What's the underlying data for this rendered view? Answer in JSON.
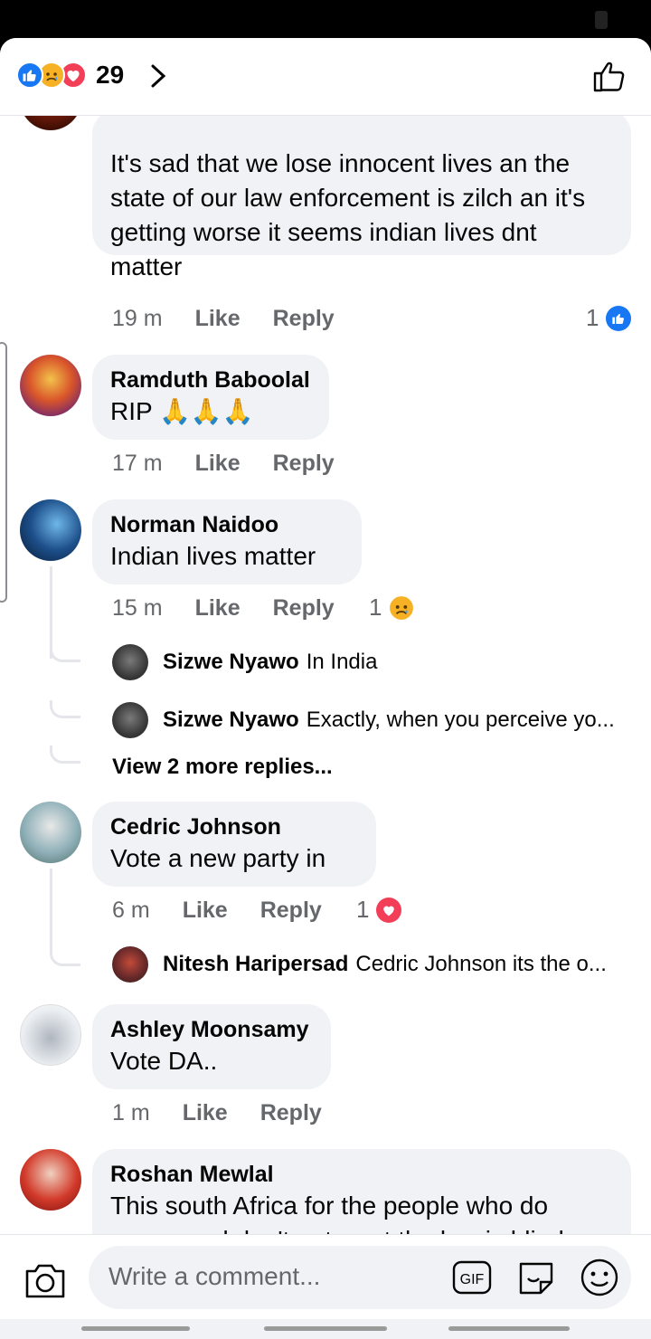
{
  "header": {
    "reaction_count": "29",
    "reaction_icons": [
      "like-icon",
      "sad-icon",
      "love-icon"
    ]
  },
  "comments": [
    {
      "text": "It's sad that we lose innocent  lives an the state of our law enforcement  is zilch an it's getting worse it seems indian lives dnt matter",
      "time": "19 m",
      "like": "Like",
      "reply": "Reply",
      "reaction_count": "1"
    },
    {
      "name": "Ramduth Baboolal",
      "text": "RIP 🙏🙏🙏",
      "time": "17 m",
      "like": "Like",
      "reply": "Reply"
    },
    {
      "name": "Norman Naidoo",
      "text": "Indian lives matter",
      "time": "15 m",
      "like": "Like",
      "reply": "Reply",
      "reaction_count": "1",
      "replies": [
        {
          "name": "Sizwe Nyawo",
          "text": "In India"
        },
        {
          "name": "Sizwe Nyawo",
          "text": "Exactly, when you perceive yo..."
        }
      ],
      "more": "View 2 more replies..."
    },
    {
      "name": "Cedric Johnson",
      "text": "Vote a new party in",
      "time": "6 m",
      "like": "Like",
      "reply": "Reply",
      "reaction_count": "1",
      "replies": [
        {
          "name": "Nitesh Haripersad",
          "text": "Cedric Johnson its the o..."
        }
      ]
    },
    {
      "name": "Ashley Moonsamy",
      "text": "Vote DA..",
      "time": "1 m",
      "like": "Like",
      "reply": "Reply"
    },
    {
      "name": "Roshan Mewlal",
      "text": "This south Africa for the people who do wrong and don't get cawt the law is blind"
    }
  ],
  "composer": {
    "placeholder": "Write a comment...",
    "gif": "GIF"
  },
  "colors": {
    "like_blue": "#1877f2",
    "love_red": "#f33e58",
    "sad_yellow": "#f7b125",
    "bubble": "#f0f2f5",
    "meta": "#65676b"
  }
}
